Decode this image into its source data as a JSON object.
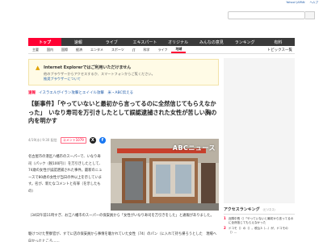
{
  "toplinks": [
    "Yahoo! JAPAN",
    "ヘルプ"
  ],
  "search": {
    "placeholder": ""
  },
  "mainnav": [
    "トップ",
    "速報",
    "ライブ",
    "エキスパート",
    "オリジナル",
    "みんなの意見",
    "ランキング",
    "有料"
  ],
  "subnav": [
    "主要",
    "国内",
    "国際",
    "経済",
    "エンタメ",
    "スポーツ",
    "IT",
    "科学",
    "ライフ",
    "地域"
  ],
  "topics_link": "トピックス一覧",
  "ie_notice": {
    "title": "Internet Explorerではご利用いただけません",
    "body": "他のブラウザーからアクセスするか、スマートフォンからご覧ください。",
    "link": "推奨ブラウザーについて"
  },
  "breaking": {
    "label": "速報",
    "text": "イスラエルがイラン攻撃とエイイル攻撃　米・ABC伝える"
  },
  "headline": "【新事件】「やっていないと最初から言ってるのに全然信じてもらえなかった」　いなり寿司を万引きしたとして誤認逮捕された女性が苦しい胸の内を明かす",
  "meta": {
    "date": "4/19(水) 9:30 配信",
    "comments": "コメント1079"
  },
  "photo": {
    "watermark": "ABCニュース"
  },
  "body_text": "名古屋市の港区八幡市のスーパーで、いなり寿司（パック（税100円））を万引きしたとして、74歳の女性が誤認逮捕された事件。最新のニュースで80歳の女性が当日の件以上を示しています。名が、新たなコメントと有罪（を示したもの）",
  "paragraphs": [
    "（34日午前11時すぎ、お江八幡市のスーパーの保安員から「女性がいなり寿司を万引きをした」と通報がありました。",
    "駆けつけた警察官が、すでに店の保安員から事情を聴かれていた女性（74）のパン（に入れて持ち帰ろうとした　現場へ向かったところ……"
  ],
  "ranking": {
    "title": "アクセスランキング",
    "sub": "（ビジネス）",
    "items": [
      {
        "num": "1",
        "text": "近隣中長（）「やっていないと最初から言ってるのに全然信じてもらえなかった"
      },
      {
        "num": "2",
        "text": "ドコモ（）の（）。税込3（...）が、ドコモの（）..."
      }
    ]
  }
}
